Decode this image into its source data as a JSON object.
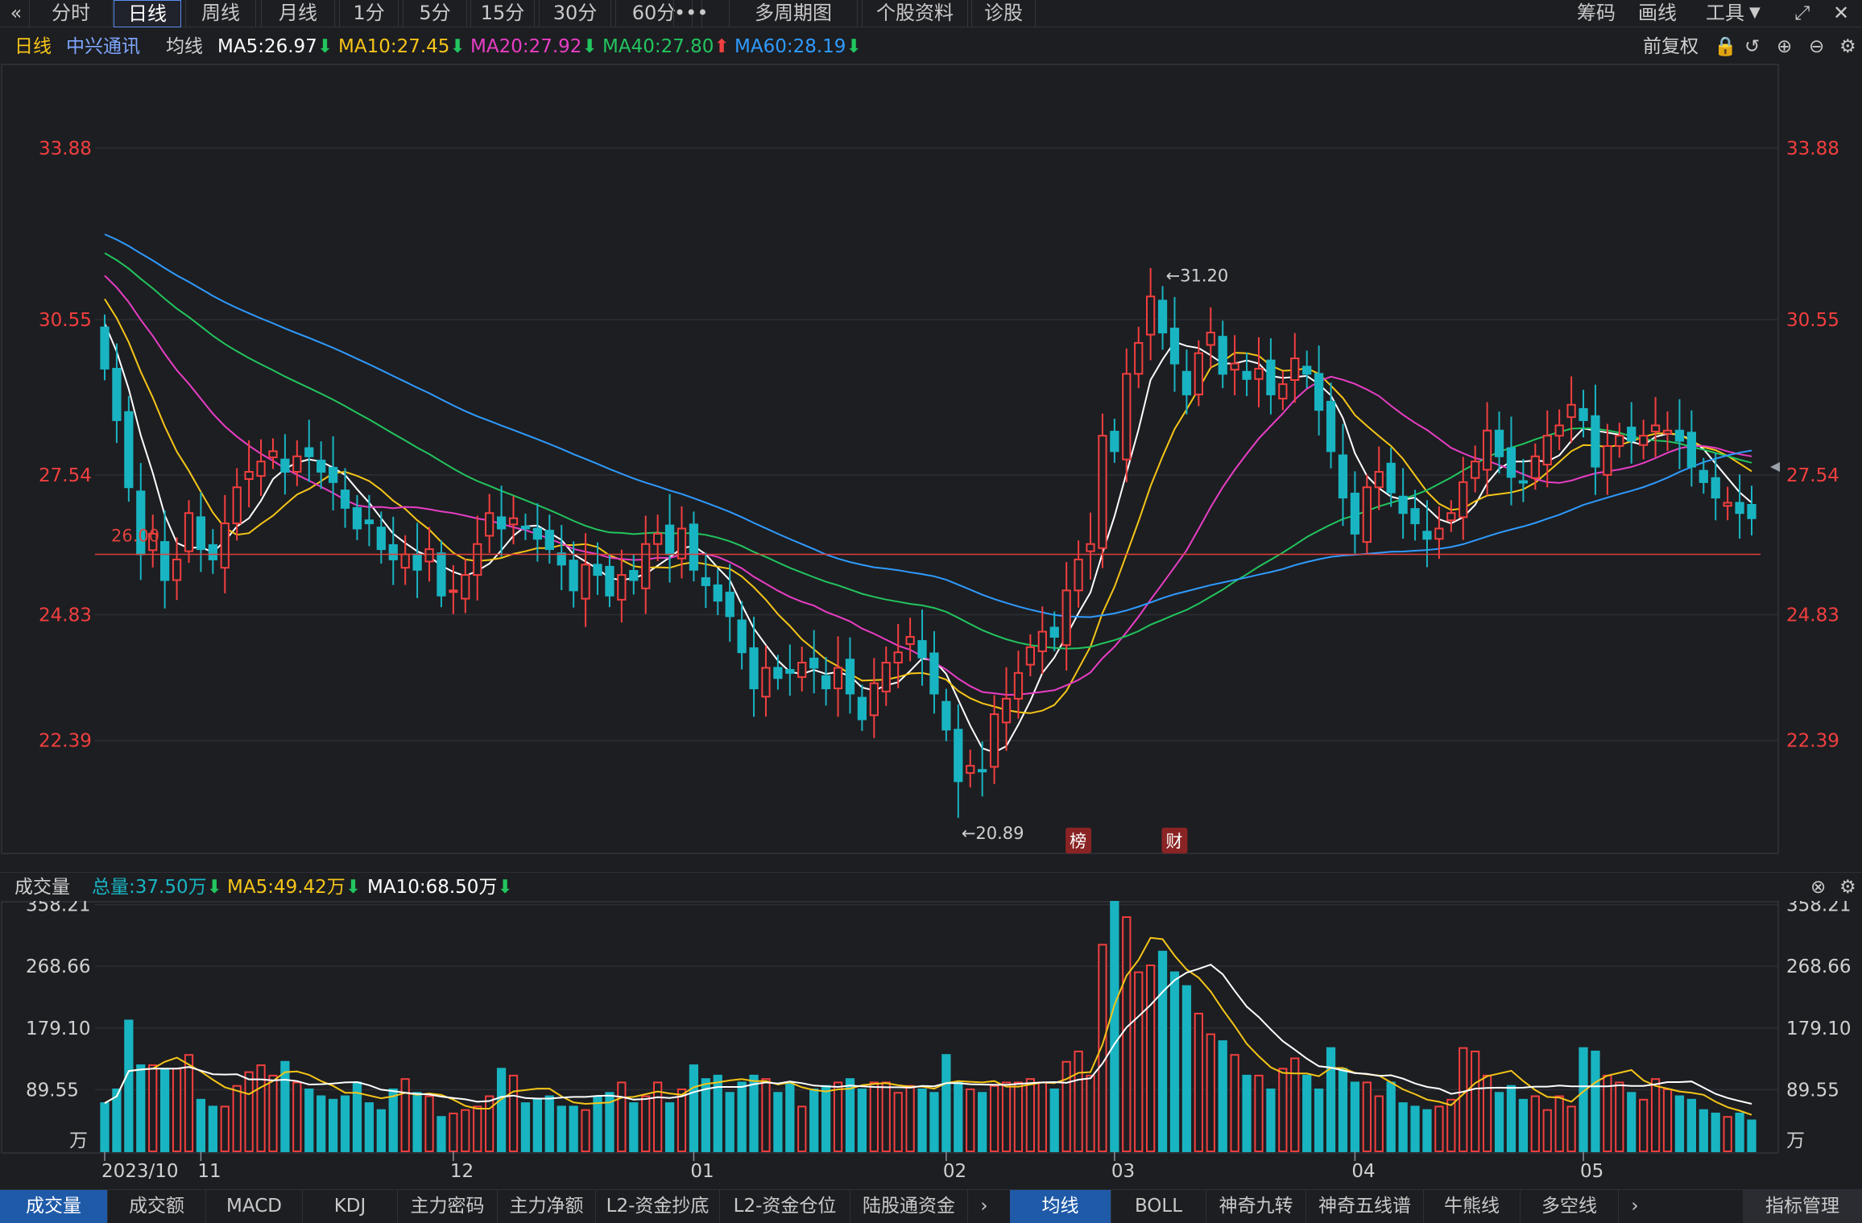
{
  "toolbar": {
    "collapse_icon": "double-chevron-left-icon",
    "buttons": [
      "分时",
      "日线",
      "周线",
      "月线",
      "1分",
      "5分",
      "15分",
      "30分",
      "60分",
      "•••",
      "多周期图",
      "个股资料",
      "诊股"
    ],
    "active": "日线",
    "right": [
      "筹码",
      "画线",
      "工具"
    ]
  },
  "legend": {
    "period": "日线",
    "stock_name": "中兴通讯",
    "avg_label": "均线",
    "ma": [
      {
        "text": "MA5:26.97",
        "color": "#ffffff",
        "dir": "down"
      },
      {
        "text": "MA10:27.45",
        "color": "#f5c518",
        "dir": "down"
      },
      {
        "text": "MA20:27.92",
        "color": "#e83ec4",
        "dir": "down"
      },
      {
        "text": "MA40:27.80",
        "color": "#22c55e",
        "dir": "up"
      },
      {
        "text": "MA60:28.19",
        "color": "#2f9bff",
        "dir": "down"
      }
    ],
    "fq_label": "前复权"
  },
  "volume_header": {
    "title": "成交量",
    "total": "总量:37.50万",
    "ma5": "MA5:49.42万",
    "ma10": "MA10:68.50万"
  },
  "bottom_tabs_left": [
    "成交量",
    "成交额",
    "MACD",
    "KDJ",
    "主力密码",
    "主力净额",
    "L2-资金抄底",
    "L2-资金仓位",
    "陆股通资金"
  ],
  "bottom_tabs_right": [
    "均线",
    "BOLL",
    "神奇九转",
    "神奇五线谱",
    "牛熊线",
    "多空线"
  ],
  "bottom_manage": "指标管理",
  "colors": {
    "up": "#f23f3f",
    "down": "#19b4c2",
    "grid": "#2c2e34",
    "bg": "#1d1e22"
  },
  "chart_data": {
    "type": "candlestick",
    "price_ticks": [
      "33.88",
      "30.55",
      "27.54",
      "24.83",
      "22.39"
    ],
    "price_tick_values": [
      33.88,
      30.55,
      27.54,
      24.83,
      22.39
    ],
    "volume_ticks": [
      "358.21",
      "268.66",
      "179.10",
      "89.55"
    ],
    "volume_tick_values": [
      358.21,
      268.66,
      179.1,
      89.55
    ],
    "volume_unit": "万",
    "x_labels": [
      "2023/10",
      "11",
      "12",
      "01",
      "02",
      "03",
      "04",
      "05"
    ],
    "x_label_index": [
      0,
      8,
      29,
      49,
      70,
      84,
      104,
      123
    ],
    "high_mark": {
      "label": "←31.20",
      "value": 31.2
    },
    "low_mark": {
      "label": "←20.89",
      "value": 20.89
    },
    "ref_line": {
      "label": "26.00",
      "value": 26.0
    },
    "event_marks": [
      {
        "label": "榜",
        "index": 81
      },
      {
        "label": "财",
        "index": 89
      }
    ],
    "ma_colors": {
      "ma5": "#ffffff",
      "ma10": "#f5c518",
      "ma20": "#e83ec4",
      "ma40": "#22c55e",
      "ma60": "#2f9bff"
    },
    "close": [
      29.6,
      28.6,
      27.3,
      26.0,
      26.4,
      25.5,
      25.9,
      26.8,
      26.1,
      25.9,
      26.6,
      27.3,
      27.6,
      27.8,
      28.0,
      27.6,
      27.9,
      27.9,
      27.6,
      27.4,
      26.9,
      26.5,
      26.6,
      26.1,
      25.9,
      26.0,
      25.7,
      26.1,
      25.2,
      25.3,
      25.6,
      26.2,
      26.8,
      26.5,
      26.7,
      26.5,
      26.3,
      26.1,
      25.8,
      25.3,
      25.8,
      25.6,
      25.2,
      25.6,
      25.5,
      26.2,
      26.4,
      26.0,
      26.5,
      25.7,
      25.4,
      25.1,
      24.8,
      24.1,
      23.4,
      23.8,
      23.6,
      23.7,
      23.9,
      23.8,
      23.4,
      23.8,
      23.3,
      22.8,
      23.5,
      23.9,
      24.1,
      24.4,
      24.0,
      23.3,
      22.6,
      21.6,
      21.9,
      21.8,
      22.9,
      23.2,
      23.7,
      24.2,
      24.5,
      24.4,
      25.3,
      25.9,
      26.2,
      28.3,
      28.0,
      29.5,
      30.1,
      31.0,
      30.3,
      29.7,
      29.1,
      29.9,
      30.3,
      29.5,
      29.7,
      29.4,
      29.6,
      29.1,
      29.3,
      29.8,
      29.5,
      28.8,
      28.0,
      27.1,
      26.4,
      27.3,
      27.6,
      27.2,
      26.8,
      26.6,
      26.3,
      26.5,
      26.8,
      27.4,
      27.8,
      28.4,
      27.9,
      27.5,
      27.4,
      27.9,
      28.3,
      28.5,
      28.9,
      28.6,
      27.7,
      28.1,
      28.3,
      28.2,
      28.3,
      28.5,
      28.4,
      28.2,
      27.7,
      27.4,
      27.1,
      27.0,
      26.8,
      26.7
    ],
    "volume": [
      70,
      90,
      190,
      125,
      125,
      120,
      120,
      140,
      75,
      65,
      65,
      95,
      115,
      125,
      110,
      130,
      100,
      90,
      80,
      75,
      80,
      100,
      70,
      60,
      90,
      105,
      85,
      80,
      50,
      55,
      60,
      65,
      80,
      120,
      110,
      70,
      75,
      80,
      65,
      65,
      60,
      80,
      85,
      100,
      70,
      80,
      100,
      70,
      90,
      125,
      105,
      110,
      85,
      100,
      110,
      105,
      85,
      100,
      65,
      90,
      95,
      100,
      105,
      90,
      100,
      100,
      85,
      95,
      90,
      85,
      140,
      100,
      90,
      85,
      95,
      100,
      100,
      105,
      100,
      90,
      130,
      145,
      110,
      300,
      380,
      340,
      260,
      270,
      290,
      260,
      240,
      200,
      170,
      160,
      140,
      110,
      110,
      90,
      120,
      135,
      110,
      90,
      150,
      120,
      100,
      100,
      80,
      100,
      70,
      65,
      60,
      65,
      75,
      150,
      145,
      110,
      85,
      95,
      75,
      80,
      60,
      80,
      65,
      150,
      145,
      110,
      100,
      85,
      75,
      105,
      90,
      80,
      75,
      60,
      55,
      50,
      55,
      45
    ]
  }
}
